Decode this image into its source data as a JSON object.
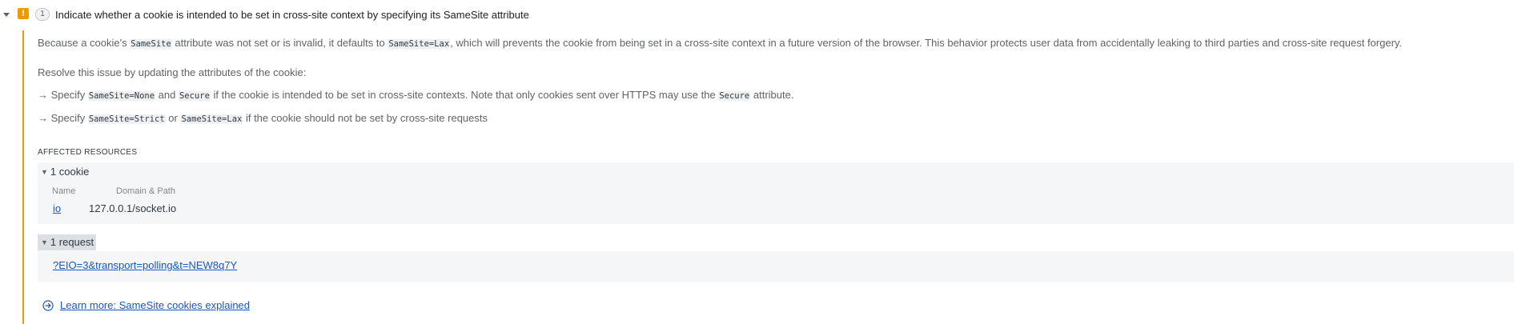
{
  "issue": {
    "badge_icon": "warning-icon",
    "badge_glyph": "!",
    "count": "1",
    "title": "Indicate whether a cookie is intended to be set in cross-site context by specifying its SameSite attribute",
    "accent_color": "#f29900"
  },
  "description": {
    "p1_part1": "Because a cookie's ",
    "p1_code1": "SameSite",
    "p1_part2": " attribute was not set or is invalid, it defaults to ",
    "p1_code2": "SameSite=Lax",
    "p1_part3": ", which will prevents the cookie from being set in a cross-site context in a future version of the browser. This behavior protects user data from accidentally leaking to third parties and cross-site request forgery.",
    "resolve": "Resolve this issue by updating the attributes of the cookie:",
    "bullet1_part1": "→ Specify ",
    "bullet1_code1": "SameSite=None",
    "bullet1_part2": " and ",
    "bullet1_code2": "Secure",
    "bullet1_part3": " if the cookie is intended to be set in cross-site contexts. Note that only cookies sent over HTTPS may use the ",
    "bullet1_code3": "Secure",
    "bullet1_part4": " attribute.",
    "bullet2_part1": "→ Specify ",
    "bullet2_code1": "SameSite=Strict",
    "bullet2_part2": " or ",
    "bullet2_code2": "SameSite=Lax",
    "bullet2_part3": " if the cookie should not be set by cross-site requests"
  },
  "affected": {
    "heading": "AFFECTED RESOURCES",
    "cookies": {
      "toggle_label": "1 cookie",
      "columns": [
        "Name",
        "Domain & Path"
      ],
      "rows": [
        {
          "name": "io",
          "domain_path": "127.0.0.1/socket.io"
        }
      ]
    },
    "requests": {
      "toggle_label": "1 request",
      "rows": [
        {
          "url": "?EIO=3&transport=polling&t=NEW8q7Y"
        }
      ]
    }
  },
  "learn_more": {
    "icon": "arrow-circle-right-icon",
    "label": "Learn more: SameSite cookies explained"
  }
}
